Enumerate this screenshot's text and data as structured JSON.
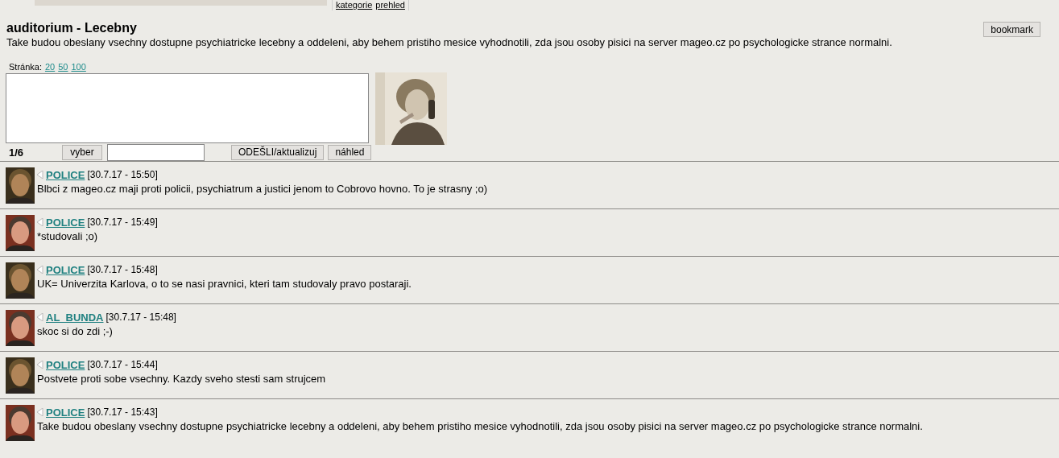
{
  "top_links": [
    "kategorie",
    "prehled"
  ],
  "title": "auditorium - Lecebny",
  "description": "Take budou obeslany vsechny dostupne psychiatricke lecebny a oddeleni, aby behem pristiho mesice vyhodnotili, zda jsou osoby pisici na server mageo.cz po psychologicke strance normalni.",
  "bookmark_button": "bookmark",
  "page_size": {
    "label": "Stránka:",
    "options": [
      "20",
      "50",
      "100"
    ]
  },
  "form": {
    "page": "1/6",
    "select_button": "vyber",
    "send_button": "ODEŠLI/aktualizuj",
    "preview_button": "náhled"
  },
  "posts": [
    {
      "author": "POLICE",
      "time": "[30.7.17 - 15:50]",
      "text": "Blbci z mageo.cz maji proti policii, psychiatrum a justici jenom to Cobrovo hovno. To je strasny ;o)"
    },
    {
      "author": "POLICE",
      "time": "[30.7.17 - 15:49]",
      "text": "*studovali ;o)"
    },
    {
      "author": "POLICE",
      "time": "[30.7.17 - 15:48]",
      "text": "UK= Univerzita Karlova, o to se nasi pravnici, kteri tam studovaly pravo postaraji."
    },
    {
      "author": "AL_BUNDA",
      "time": "[30.7.17 - 15:48]",
      "text": "skoc si do zdi ;-)"
    },
    {
      "author": "POLICE",
      "time": "[30.7.17 - 15:44]",
      "text": "Postvete proti sobe vsechny. Kazdy sveho stesti sam strujcem"
    },
    {
      "author": "POLICE",
      "time": "[30.7.17 - 15:43]",
      "text": "Take budou obeslany vsechny dostupne psychiatricke lecebny a oddeleni, aby behem pristiho mesice vyhodnotili, zda jsou osoby pisici na server mageo.cz po psychologicke strance normalni."
    }
  ]
}
